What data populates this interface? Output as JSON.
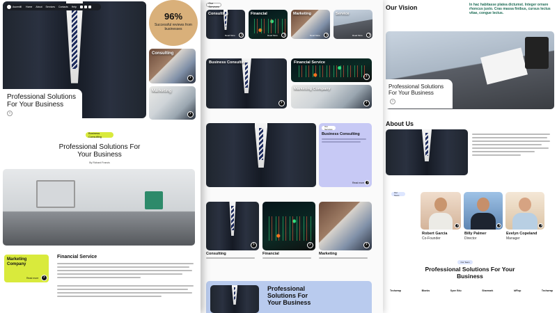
{
  "page1": {
    "logo": "Ascentill",
    "nav": [
      "Home",
      "About",
      "Services",
      "Contacts",
      "Help"
    ],
    "hero_title": "Professional Solutions For Your Business",
    "stat_value": "96%",
    "stat_caption": "Successful reviews from businesses",
    "side_cards": [
      "Consulting",
      "Marketing"
    ],
    "badge": "Business Consulting",
    "section_title": "Professional Solutions For Your Business",
    "byline": "By Richard Francis",
    "card_marketing": "Marketing Company",
    "card_marketing_link": "Read more",
    "financial_title": "Financial Service"
  },
  "page2": {
    "tag": "Our Services",
    "top_cards": [
      "Consulting",
      "Financial",
      "Marketing",
      "Service"
    ],
    "top_links": [
      "Read More",
      "Read More",
      "Read More",
      "Read More"
    ],
    "row2_big": "Business Consulting",
    "row2_right": [
      "Financial Service",
      "Marketing Company"
    ],
    "tag2": "Our Services",
    "consulting_title": "Business Consulting",
    "consulting_link": "Read more",
    "bottom_cards": [
      "Consulting",
      "Financial",
      "Marketing"
    ],
    "cta_title": "Professional Solutions For Your Business"
  },
  "page3": {
    "vision_title": "Our Vision",
    "vision_text": "In hac habitasse platea dictumst. Integer ornare rhoncus justo. Cras massa finibus, cursus lectus vitae, congue lectus.",
    "hero_title": "Professional Solutions For Your Business",
    "about_title": "About Us",
    "team_tag": "Our Team",
    "team": [
      {
        "name": "Robert Garcia",
        "role": "Co-Founder"
      },
      {
        "name": "Billy Palmer",
        "role": "Director"
      },
      {
        "name": "Evelyn Copeland",
        "role": "Manager"
      }
    ],
    "bottom_tag": "Our Team",
    "bottom_title": "Professional Solutions For Your Business",
    "logos": [
      "Techwrap",
      "Blonks",
      "Syne Edu",
      "Sharmark",
      "IdFlop",
      "Techwrap"
    ]
  },
  "colors": {
    "accent": "#d9ea3c",
    "tan": "#d9b07a",
    "lavender": "#c7c9f5",
    "dark": "#111111"
  }
}
